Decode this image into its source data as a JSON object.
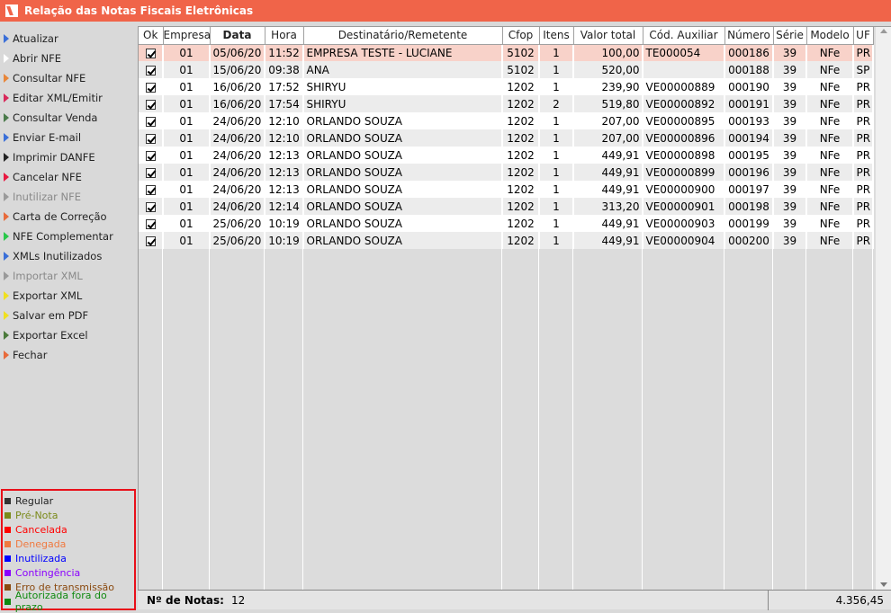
{
  "window": {
    "title": "Relação das Notas Fiscais Eletrônicas"
  },
  "menu": [
    {
      "label": "Atualizar",
      "color": "#3a6fd8",
      "disabled": false,
      "name": "atualizar"
    },
    {
      "label": "Abrir NFE",
      "color": "#ffffff",
      "disabled": false,
      "name": "abrir-nfe"
    },
    {
      "label": "Consultar NFE",
      "color": "#e8863a",
      "disabled": false,
      "name": "consultar-nfe"
    },
    {
      "label": "Editar XML/Emitir",
      "color": "#d8285a",
      "disabled": false,
      "name": "editar-xml-emitir"
    },
    {
      "label": "Consultar Venda",
      "color": "#4a7a4a",
      "disabled": false,
      "name": "consultar-venda"
    },
    {
      "label": "Enviar E-mail",
      "color": "#3a6fd8",
      "disabled": false,
      "name": "enviar-email"
    },
    {
      "label": "Imprimir DANFE",
      "color": "#222222",
      "disabled": false,
      "name": "imprimir-danfe"
    },
    {
      "label": "Cancelar NFE",
      "color": "#e81840",
      "disabled": false,
      "name": "cancelar-nfe"
    },
    {
      "label": "Inutilizar NFE",
      "color": "#9a9a9a",
      "disabled": true,
      "name": "inutilizar-nfe"
    },
    {
      "label": "Carta de Correção",
      "color": "#e86a3a",
      "disabled": false,
      "name": "carta-de-correcao"
    },
    {
      "label": "NFE Complementar",
      "color": "#2ac84a",
      "disabled": false,
      "name": "nfe-complementar"
    },
    {
      "label": "XMLs Inutilizados",
      "color": "#3a6fd8",
      "disabled": false,
      "name": "xmls-inutilizados"
    },
    {
      "label": "Importar XML",
      "color": "#9a9a9a",
      "disabled": true,
      "name": "importar-xml"
    },
    {
      "label": "Exportar XML",
      "color": "#f0e020",
      "disabled": false,
      "name": "exportar-xml"
    },
    {
      "label": "Salvar em PDF",
      "color": "#f0e020",
      "disabled": false,
      "name": "salvar-em-pdf"
    },
    {
      "label": "Exportar Excel",
      "color": "#4a7a3a",
      "disabled": false,
      "name": "exportar-excel"
    },
    {
      "label": "Fechar",
      "color": "#e86a3a",
      "disabled": false,
      "name": "fechar"
    }
  ],
  "legend": [
    {
      "label": "Regular",
      "color": "#333333",
      "text_color": "#222222"
    },
    {
      "label": "Pré-Nota",
      "color": "#7a8a1a",
      "text_color": "#7a8a1a"
    },
    {
      "label": "Cancelada",
      "color": "#ff0000",
      "text_color": "#ff0000"
    },
    {
      "label": "Denegada",
      "color": "#f07a40",
      "text_color": "#f07a40"
    },
    {
      "label": "Inutilizada",
      "color": "#0000ff",
      "text_color": "#0000ff"
    },
    {
      "label": "Contingência",
      "color": "#8a00ff",
      "text_color": "#8a00ff"
    },
    {
      "label": "Erro de transmissão",
      "color": "#8a4a10",
      "text_color": "#8a4a10"
    },
    {
      "label": "Autorizada fora do prazo",
      "color": "#108a10",
      "text_color": "#108a10"
    }
  ],
  "table": {
    "columns": [
      "Ok",
      "Empresa",
      "Data",
      "Hora",
      "Destinatário/Remetente",
      "Cfop",
      "Itens",
      "Valor total",
      "Cód. Auxiliar",
      "Número",
      "Série",
      "Modelo",
      "UF"
    ],
    "rows": [
      [
        "01",
        "05/06/20",
        "11:52",
        "EMPRESA TESTE - LUCIANE",
        "5102",
        "1",
        "100,00",
        "TE000054",
        "000186",
        "39",
        "NFe",
        "PR"
      ],
      [
        "01",
        "15/06/20",
        "09:38",
        "ANA",
        "5102",
        "1",
        "520,00",
        "",
        "000188",
        "39",
        "NFe",
        "SP"
      ],
      [
        "01",
        "16/06/20",
        "17:52",
        "SHIRYU",
        "1202",
        "1",
        "239,90",
        "VE00000889",
        "000190",
        "39",
        "NFe",
        "PR"
      ],
      [
        "01",
        "16/06/20",
        "17:54",
        "SHIRYU",
        "1202",
        "2",
        "519,80",
        "VE00000892",
        "000191",
        "39",
        "NFe",
        "PR"
      ],
      [
        "01",
        "24/06/20",
        "12:10",
        "ORLANDO SOUZA",
        "1202",
        "1",
        "207,00",
        "VE00000895",
        "000193",
        "39",
        "NFe",
        "PR"
      ],
      [
        "01",
        "24/06/20",
        "12:10",
        "ORLANDO SOUZA",
        "1202",
        "1",
        "207,00",
        "VE00000896",
        "000194",
        "39",
        "NFe",
        "PR"
      ],
      [
        "01",
        "24/06/20",
        "12:13",
        "ORLANDO SOUZA",
        "1202",
        "1",
        "449,91",
        "VE00000898",
        "000195",
        "39",
        "NFe",
        "PR"
      ],
      [
        "01",
        "24/06/20",
        "12:13",
        "ORLANDO SOUZA",
        "1202",
        "1",
        "449,91",
        "VE00000899",
        "000196",
        "39",
        "NFe",
        "PR"
      ],
      [
        "01",
        "24/06/20",
        "12:13",
        "ORLANDO SOUZA",
        "1202",
        "1",
        "449,91",
        "VE00000900",
        "000197",
        "39",
        "NFe",
        "PR"
      ],
      [
        "01",
        "24/06/20",
        "12:14",
        "ORLANDO SOUZA",
        "1202",
        "1",
        "313,20",
        "VE00000901",
        "000198",
        "39",
        "NFe",
        "PR"
      ],
      [
        "01",
        "25/06/20",
        "10:19",
        "ORLANDO SOUZA",
        "1202",
        "1",
        "449,91",
        "VE00000903",
        "000199",
        "39",
        "NFe",
        "PR"
      ],
      [
        "01",
        "25/06/20",
        "10:19",
        "ORLANDO SOUZA",
        "1202",
        "1",
        "449,91",
        "VE00000904",
        "000200",
        "39",
        "NFe",
        "PR"
      ]
    ]
  },
  "footer": {
    "count_label": "Nº de Notas:",
    "count": "12",
    "total": "4.356,45"
  }
}
